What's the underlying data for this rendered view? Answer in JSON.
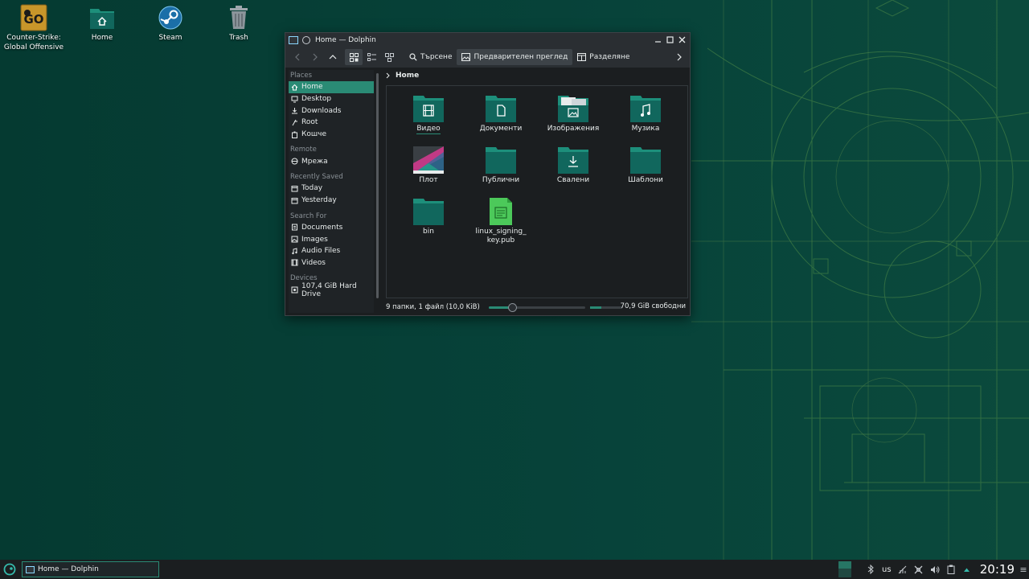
{
  "colors": {
    "desktop_bg": "#073d33",
    "accent": "#2a8b75",
    "window_bg": "#1b1e20",
    "titlebar_bg": "#2a2e32",
    "folder_top": "#1d8f7b",
    "folder_body": "#11675d"
  },
  "desktop": {
    "icons": [
      {
        "label": "Counter-Strike:\nGlobal Offensive",
        "icon": "csgo-game-icon"
      },
      {
        "label": "Home",
        "icon": "home-folder-icon"
      },
      {
        "label": "Steam",
        "icon": "steam-icon"
      },
      {
        "label": "Trash",
        "icon": "trash-icon"
      }
    ]
  },
  "window": {
    "title": "Home — Dolphin",
    "toolbar": {
      "search": "Търсене",
      "preview": "Предварителен преглед",
      "split": "Разделяне"
    },
    "places": {
      "sections": [
        {
          "title": "Places",
          "items": [
            {
              "label": "Home",
              "icon": "home-icon",
              "selected": true
            },
            {
              "label": "Desktop",
              "icon": "desktop-icon"
            },
            {
              "label": "Downloads",
              "icon": "download-icon"
            },
            {
              "label": "Root",
              "icon": "root-icon"
            },
            {
              "label": "Кошче",
              "icon": "trash-icon"
            }
          ]
        },
        {
          "title": "Remote",
          "items": [
            {
              "label": "Мрежа",
              "icon": "network-icon"
            }
          ]
        },
        {
          "title": "Recently Saved",
          "items": [
            {
              "label": "Today",
              "icon": "calendar-icon"
            },
            {
              "label": "Yesterday",
              "icon": "calendar-icon"
            }
          ]
        },
        {
          "title": "Search For",
          "items": [
            {
              "label": "Documents",
              "icon": "document-icon"
            },
            {
              "label": "Images",
              "icon": "image-icon"
            },
            {
              "label": "Audio Files",
              "icon": "audio-icon"
            },
            {
              "label": "Videos",
              "icon": "video-icon"
            }
          ]
        },
        {
          "title": "Devices",
          "items": [
            {
              "label": "107,4 GiB Hard Drive",
              "icon": "hard-drive-icon"
            }
          ]
        }
      ]
    },
    "breadcrumb": "Home",
    "files": [
      {
        "label": "Видео",
        "icon": "video-folder-icon"
      },
      {
        "label": "Документи",
        "icon": "documents-folder-icon"
      },
      {
        "label": "Изображения",
        "icon": "pictures-folder-icon"
      },
      {
        "label": "Музика",
        "icon": "music-folder-icon"
      },
      {
        "label": "Плот",
        "icon": "desktop-folder-icon"
      },
      {
        "label": "Публични",
        "icon": "public-folder-icon"
      },
      {
        "label": "Свалени",
        "icon": "downloads-folder-icon"
      },
      {
        "label": "Шаблони",
        "icon": "templates-folder-icon"
      },
      {
        "label": "bin",
        "icon": "folder-icon"
      },
      {
        "label": "linux_signing_\nkey.pub",
        "icon": "key-file-icon"
      }
    ],
    "status": {
      "summary": "9 папки, 1 файл (10,0 KiB)",
      "free_space": "70,9 GiB свободни",
      "zoom_level": 0.25,
      "disk_used_fraction": 0.34
    }
  },
  "taskbar": {
    "task": "Home — Dolphin",
    "keyboard_layout": "us",
    "clock": "20:19"
  }
}
